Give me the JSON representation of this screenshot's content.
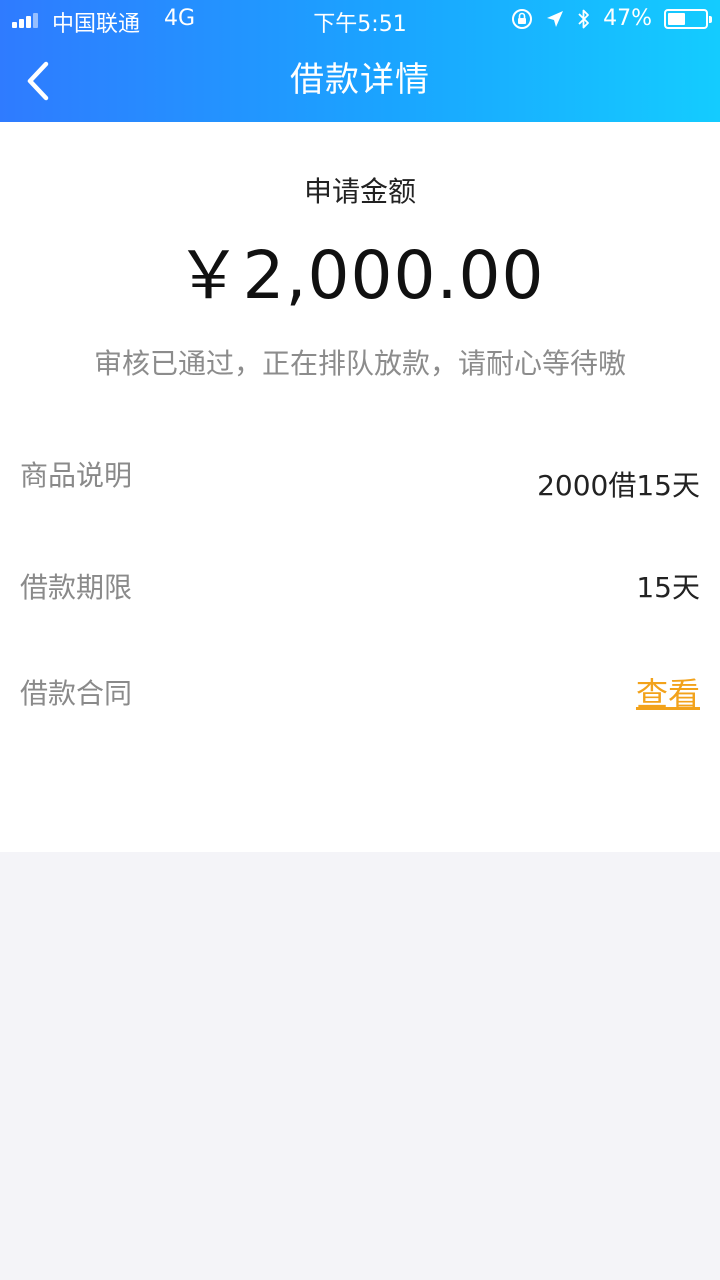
{
  "status_bar": {
    "carrier": "中国联通",
    "network": "4G",
    "time": "下午5:51",
    "battery_percent": "47%",
    "battery_level": 0.47,
    "icons": [
      "orientation-lock-icon",
      "location-arrow-icon",
      "bluetooth-icon"
    ]
  },
  "nav": {
    "back_icon": "chevron-left-icon",
    "title": "借款详情"
  },
  "loan": {
    "amount_label": "申请金额",
    "amount": "￥2,000.00",
    "status_message": "审核已通过，正在排队放款，请耐心等待嗷"
  },
  "details": [
    {
      "label": "商品说明",
      "value": "2000借15天"
    },
    {
      "label": "借款期限",
      "value": "15天"
    },
    {
      "label": "借款合同",
      "value": "查看",
      "is_link": true
    }
  ],
  "colors": {
    "header_gradient_start": "#2f7bff",
    "header_gradient_end": "#14ccff",
    "link": "#f2a21b",
    "page_background": "#f4f4f8"
  }
}
